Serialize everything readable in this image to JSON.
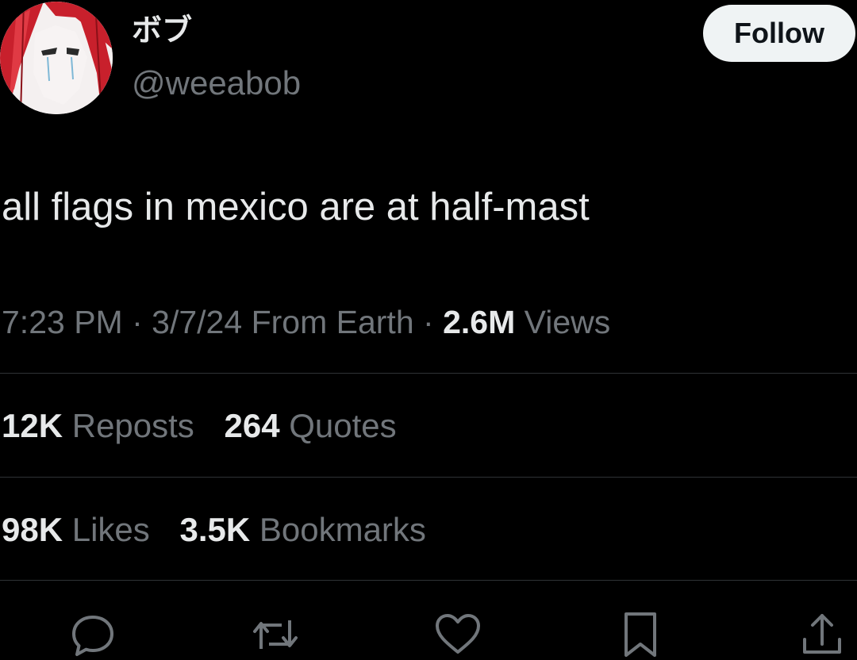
{
  "author": {
    "display_name": "ボブ",
    "handle": "@weeabob"
  },
  "follow_label": "Follow",
  "tweet": {
    "text": "all flags in mexico are at half-mast",
    "time": "7:23 PM",
    "date": "3/7/24",
    "source": "From Earth",
    "separator": "·",
    "views_count": "2.6M",
    "views_label": "Views"
  },
  "stats": {
    "reposts_count": "12K",
    "reposts_label": "Reposts",
    "quotes_count": "264",
    "quotes_label": "Quotes",
    "likes_count": "98K",
    "likes_label": "Likes",
    "bookmarks_count": "3.5K",
    "bookmarks_label": "Bookmarks"
  },
  "actions": {
    "reply_icon": "reply-icon",
    "repost_icon": "repost-icon",
    "like_icon": "heart-icon",
    "bookmark_icon": "bookmark-icon",
    "share_icon": "share-icon"
  },
  "colors": {
    "background": "#000000",
    "primary_text": "#e7e9ea",
    "secondary_text": "#71767b",
    "divider": "#2f3336",
    "follow_bg": "#eff3f4",
    "avatar_accent": "#c8202c"
  }
}
